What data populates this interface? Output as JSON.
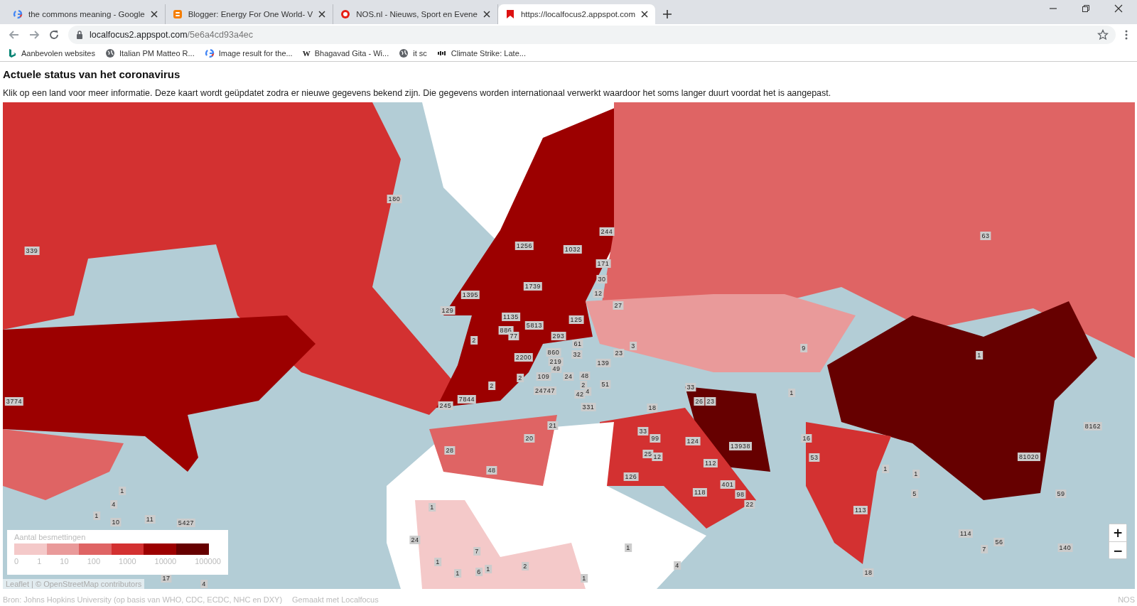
{
  "browser": {
    "tabs": [
      {
        "title": "the commons meaning - Google",
        "selected": false
      },
      {
        "title": "Blogger: Energy For One World- V",
        "selected": false
      },
      {
        "title": "NOS.nl - Nieuws, Sport en Evene",
        "selected": false
      },
      {
        "title": "https://localfocus2.appspot.com",
        "selected": true
      }
    ],
    "address": {
      "host": "localfocus2.appspot.com",
      "path": "/5e6a4cd93a4ec"
    },
    "bookmarks": [
      {
        "label": "Aanbevolen websites"
      },
      {
        "label": "Italian PM Matteo R..."
      },
      {
        "label": "Image result for the..."
      },
      {
        "label": "Bhagavad Gita - Wi...",
        "glyph": "W"
      },
      {
        "label": "it sc"
      },
      {
        "label": "Climate Strike: Late..."
      }
    ]
  },
  "page": {
    "title": "Actuele status van het coronavirus",
    "description": "Klik op een land voor meer informatie. Deze kaart wordt geüpdatet zodra er nieuwe gegevens bekend zijn. Die gegevens worden internationaal verwerkt waardoor het soms langer duurt voordat het is aangepast.",
    "map": {
      "kind": "picture",
      "labels": [
        "180",
        "244",
        "63",
        "339",
        "1256",
        "1032",
        "171",
        "30",
        "1739",
        "1395",
        "12",
        "27",
        "129",
        "1135",
        "125",
        "5813",
        "886",
        "77",
        "293",
        "2",
        "61",
        "3",
        "9",
        "2200",
        "860",
        "32",
        "23",
        "1",
        "219",
        "139",
        "49",
        "2",
        "109",
        "24",
        "48",
        "2",
        "2",
        "51",
        "33",
        "24747",
        "42",
        "4",
        "1",
        "3774",
        "7844",
        "26",
        "23",
        "245",
        "331",
        "18",
        "21",
        "8162",
        "33",
        "20",
        "99",
        "124",
        "16",
        "13938",
        "28",
        "25",
        "12",
        "53",
        "81020",
        "112",
        "48",
        "1",
        "126",
        "1",
        "401",
        "1",
        "118",
        "98",
        "5",
        "59",
        "4",
        "1",
        "22",
        "113",
        "1",
        "10",
        "11",
        "5427",
        "114",
        "24",
        "56",
        "7",
        "1",
        "7",
        "140",
        "1",
        "1",
        "6",
        "1",
        "2",
        "4",
        "18",
        "17",
        "1",
        "4"
      ],
      "legend": {
        "title": "Aantal besmettingen",
        "swatches": [
          {
            "color": "#f4c9c9"
          },
          {
            "color": "#e99a9a"
          },
          {
            "color": "#df6464"
          },
          {
            "color": "#d33131"
          },
          {
            "color": "#9c0000"
          },
          {
            "color": "#660000"
          }
        ],
        "ticks": [
          "0",
          "1",
          "10",
          "100",
          "1000",
          "10000",
          "100000"
        ]
      },
      "zoom": {
        "in": "+",
        "out": "−"
      },
      "attribution": "Leaflet | © OpenStreetMap contributors"
    },
    "footer": {
      "source": "Bron: Johns Hopkins University (op basis van WHO, CDC, ECDC, NHC en DXY)",
      "credit": "Gemaakt met Localfocus",
      "brand": "NOS"
    }
  }
}
